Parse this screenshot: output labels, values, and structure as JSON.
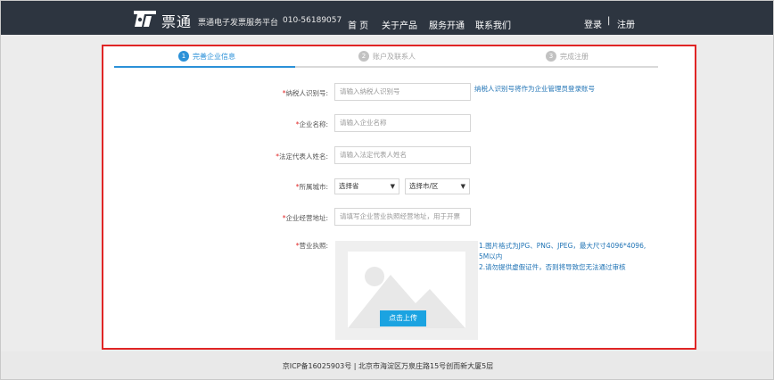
{
  "header": {
    "brand": "票通",
    "platform": "票通电子发票服务平台",
    "phone": "010-56189057",
    "nav": [
      "首 页",
      "关于产品",
      "服务开通",
      "联系我们"
    ],
    "login": "登录",
    "separator": "|",
    "register": "注册",
    "background_color": "#2d3540"
  },
  "steps": [
    {
      "number": "1",
      "label": "完善企业信息",
      "active": true
    },
    {
      "number": "2",
      "label": "账户及联系人",
      "active": false
    },
    {
      "number": "3",
      "label": "完成注册",
      "active": false
    }
  ],
  "form": {
    "required_mark": "*",
    "taxpayer_id": {
      "label": "纳税人识别号:",
      "placeholder": "请输入纳税人识别号",
      "hint": "纳税人识别号将作为企业管理员登录账号"
    },
    "company_name": {
      "label": "企业名称:",
      "placeholder": "请输入企业名称"
    },
    "legal_rep": {
      "label": "法定代表人姓名:",
      "placeholder": "请输入法定代表人姓名"
    },
    "city": {
      "label": "所属城市:",
      "province_value": "选择省",
      "city_value": "选择市/区"
    },
    "address": {
      "label": "企业经营地址:",
      "placeholder": "请填写企业营业执照经营地址，用于开票"
    },
    "license": {
      "label": "营业执照:",
      "hint_lines": [
        "1.图片格式为JPG、PNG、JPEG，最大尺寸4096*4096,",
        "5M以内",
        "2.请勿提供虚假证件，否则将导致您无法通过审核"
      ],
      "upload_button": "点击上传"
    }
  },
  "footer": {
    "text": "京ICP备16025903号 | 北京市海淀区万泉庄路15号创而新大厦5层"
  },
  "colors": {
    "accent": "#2b91d8",
    "link": "#1f73b5",
    "upload": "#1ba3e1",
    "highlight_border": "#e02525"
  }
}
